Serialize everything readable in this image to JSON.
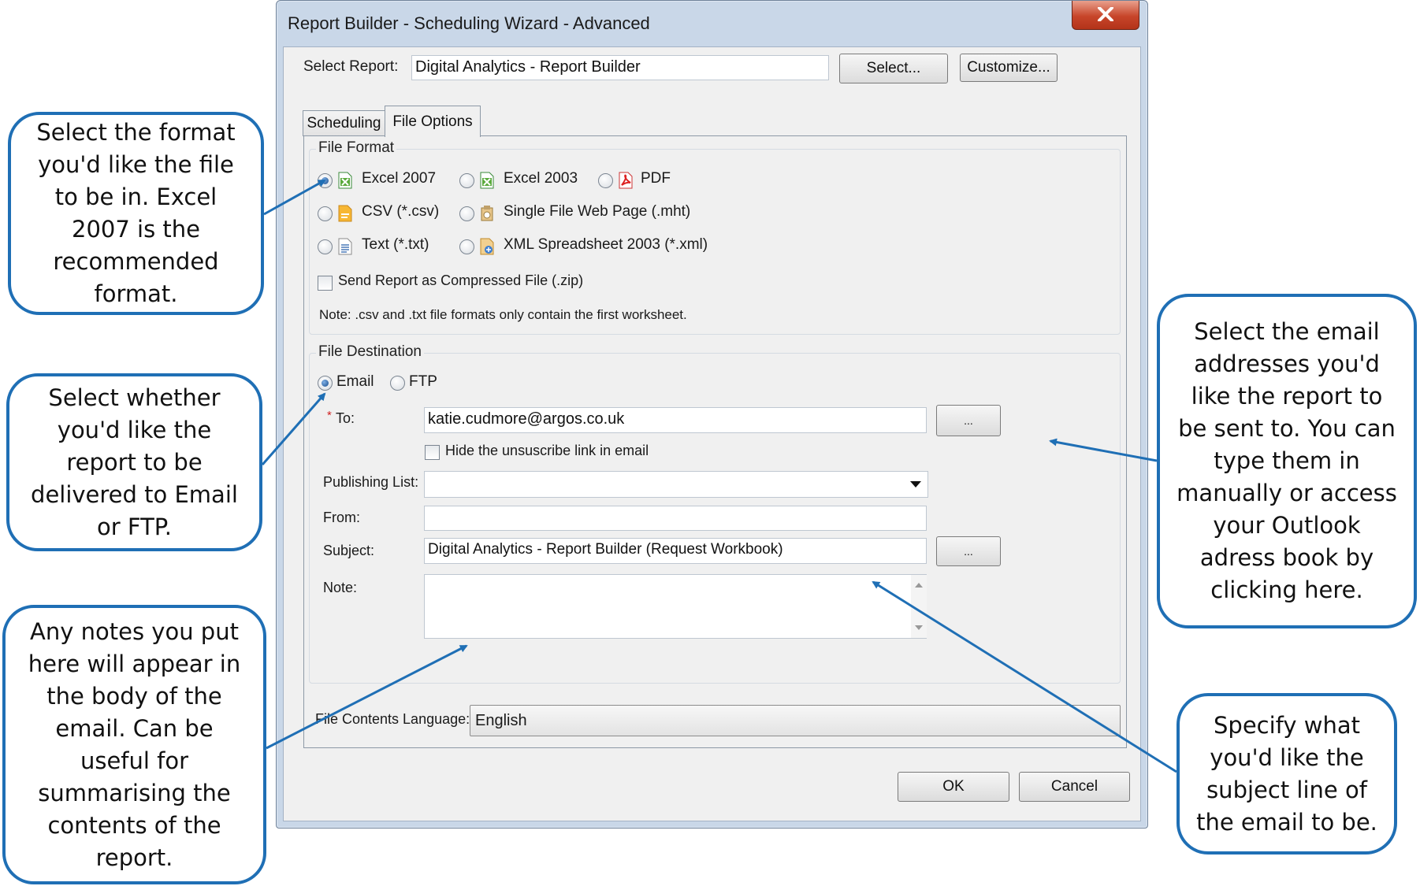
{
  "window": {
    "title": "Report Builder - Scheduling Wizard - Advanced"
  },
  "select_report": {
    "label": "Select Report:",
    "value": "Digital Analytics - Report Builder",
    "select_button": "Select...",
    "customize_button": "Customize..."
  },
  "tabs": [
    {
      "label": "Scheduling",
      "active": false
    },
    {
      "label": "File Options",
      "active": true
    }
  ],
  "file_format": {
    "title": "File Format",
    "options": [
      {
        "label": "Excel 2007",
        "icon": "excel-2007-icon",
        "checked": true
      },
      {
        "label": "Excel 2003",
        "icon": "excel-2003-icon",
        "checked": false
      },
      {
        "label": "PDF",
        "icon": "pdf-icon",
        "checked": false
      },
      {
        "label": "CSV (*.csv)",
        "icon": "csv-icon",
        "checked": false
      },
      {
        "label": "Single File Web Page (.mht)",
        "icon": "web-page-icon",
        "checked": false
      },
      {
        "label": "Text (*.txt)",
        "icon": "text-file-icon",
        "checked": false
      },
      {
        "label": "XML Spreadsheet 2003 (*.xml)",
        "icon": "xml-spreadsheet-icon",
        "checked": false
      }
    ],
    "compress_label": "Send Report as Compressed File (.zip)",
    "note": "Note: .csv and .txt file formats only contain the first worksheet."
  },
  "file_destination": {
    "title": "File Destination",
    "email_label": "Email",
    "ftp_label": "FTP",
    "required_marker": "*",
    "to_label": "To:",
    "to_value": "katie.cudmore@argos.co.uk",
    "browse_label": "...",
    "hide_unsubscribe_label": "Hide the unsuscribe link in email",
    "publishing_list_label": "Publishing List:",
    "publishing_list_value": "",
    "from_label": "From:",
    "from_value": "",
    "subject_label": "Subject:",
    "subject_value": "Digital Analytics - Report Builder (Request Workbook)",
    "note_label": "Note:",
    "note_value": ""
  },
  "language": {
    "label": "File Contents Language:",
    "value": "English"
  },
  "footer": {
    "ok": "OK",
    "cancel": "Cancel"
  },
  "callouts": {
    "format": "Select the format you'd like the file to be in. Excel 2007 is the recommended format.",
    "destination": "Select whether you'd like the report to be delivered to Email or FTP.",
    "notes": "Any notes you put here will appear in the body of the email. Can be useful for summarising the contents of the report.",
    "email": "Select the email addresses you'd like the report to be sent to. You can type them in manually or access your Outlook adress book by clicking here.",
    "subject": "Specify what you'd like  the subject line of the email to be."
  },
  "colors": {
    "callout_border": "#1f6fb5",
    "arrow": "#1f6fb5",
    "close_button": "#c7452a"
  }
}
